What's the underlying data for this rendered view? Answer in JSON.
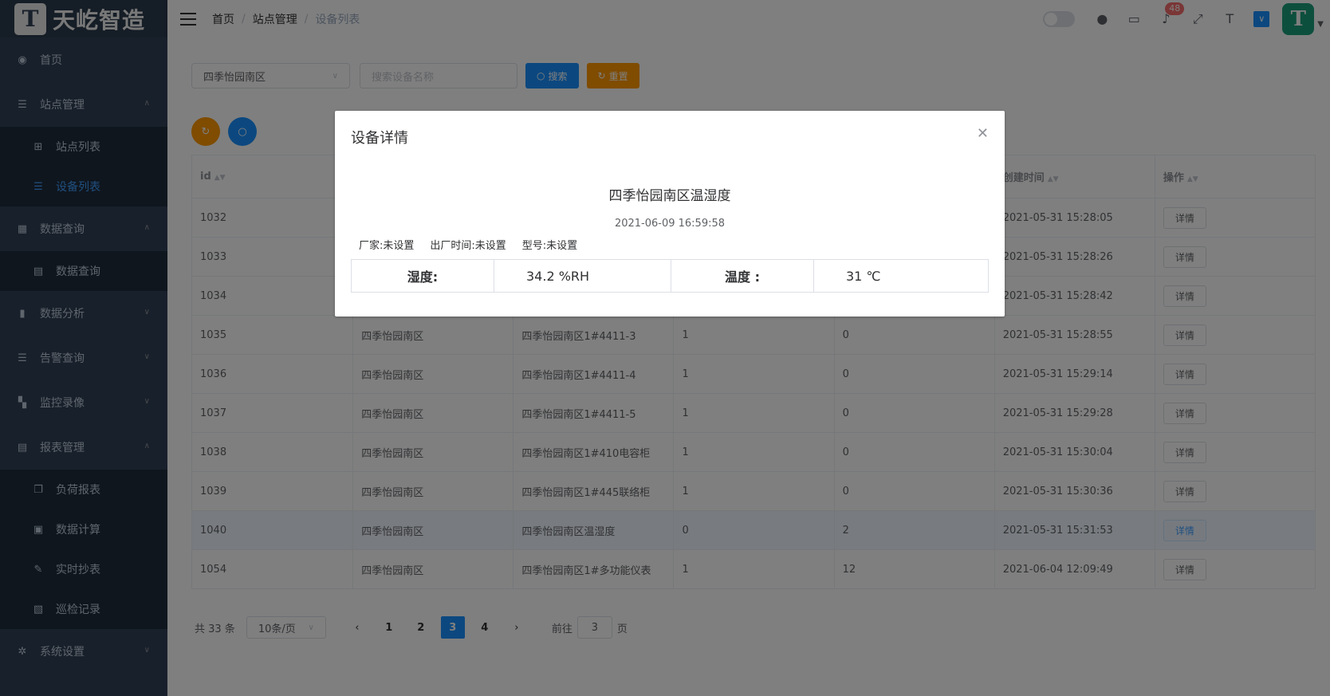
{
  "brand": {
    "logo_letter": "T",
    "name": "天屹智造"
  },
  "sidebar": {
    "items": [
      {
        "label": "首页",
        "icon": "dashboard-icon"
      },
      {
        "label": "站点管理",
        "icon": "list-icon",
        "expanded": true,
        "children": [
          {
            "label": "站点列表",
            "icon": "tree-table-icon"
          },
          {
            "label": "设备列表",
            "icon": "list-icon",
            "active": true
          }
        ]
      },
      {
        "label": "数据查询",
        "icon": "table-icon",
        "expanded": true,
        "children": [
          {
            "label": "数据查询",
            "icon": "book-icon"
          }
        ]
      },
      {
        "label": "数据分析",
        "icon": "chart-icon"
      },
      {
        "label": "告警查询",
        "icon": "list-icon"
      },
      {
        "label": "监控录像",
        "icon": "grid-icon"
      },
      {
        "label": "报表管理",
        "icon": "book-icon",
        "expanded": true,
        "children": [
          {
            "label": "负荷报表",
            "icon": "copy-icon"
          },
          {
            "label": "数据计算",
            "icon": "calendar-icon"
          },
          {
            "label": "实时抄表",
            "icon": "edit-doc-icon"
          },
          {
            "label": "巡检记录",
            "icon": "document-icon"
          }
        ]
      },
      {
        "label": "系统设置",
        "icon": "settings-icon"
      }
    ]
  },
  "header": {
    "breadcrumb": [
      "首页",
      "站点管理",
      "设备列表"
    ],
    "notification_count": "48",
    "avatar_letter": "T"
  },
  "filters": {
    "area_select": "四季怡园南区",
    "search_placeholder": "搜索设备名称",
    "search_label": "搜索",
    "reset_label": "重置"
  },
  "table": {
    "columns": [
      "id",
      "",
      "",
      "",
      "",
      "创建时间",
      "操作"
    ],
    "detail_label": "详情",
    "rows": [
      [
        "1032",
        "",
        "",
        "",
        "",
        "2021-05-31 15:28:05"
      ],
      [
        "1033",
        "",
        "",
        "",
        "",
        "2021-05-31 15:28:26"
      ],
      [
        "1034",
        "",
        "",
        "",
        "",
        "2021-05-31 15:28:42"
      ],
      [
        "1035",
        "四季怡园南区",
        "四季怡园南区1#4411-3",
        "1",
        "0",
        "2021-05-31 15:28:55"
      ],
      [
        "1036",
        "四季怡园南区",
        "四季怡园南区1#4411-4",
        "1",
        "0",
        "2021-05-31 15:29:14"
      ],
      [
        "1037",
        "四季怡园南区",
        "四季怡园南区1#4411-5",
        "1",
        "0",
        "2021-05-31 15:29:28"
      ],
      [
        "1038",
        "四季怡园南区",
        "四季怡园南区1#410电容柜",
        "1",
        "0",
        "2021-05-31 15:30:04"
      ],
      [
        "1039",
        "四季怡园南区",
        "四季怡园南区1#445联络柜",
        "1",
        "0",
        "2021-05-31 15:30:36"
      ],
      [
        "1040",
        "四季怡园南区",
        "四季怡园南区温湿度",
        "0",
        "2",
        "2021-05-31 15:31:53"
      ],
      [
        "1054",
        "四季怡园南区",
        "四季怡园南区1#多功能仪表",
        "1",
        "12",
        "2021-06-04 12:09:49"
      ]
    ],
    "highlight_row": 8
  },
  "pagination": {
    "total": "共 33 条",
    "page_size": "10条/页",
    "pages": [
      "1",
      "2",
      "3",
      "4"
    ],
    "current": "3",
    "goto_prefix": "前往",
    "goto_value": "3",
    "goto_suffix": "页"
  },
  "dialog": {
    "title": "设备详情",
    "device_name": "四季怡园南区温湿度",
    "time": "2021-06-09 16:59:58",
    "meta": [
      "厂家:未设置",
      "出厂时间:未设置",
      "型号:未设置"
    ],
    "readings": [
      {
        "label": "湿度:",
        "value": "34.2 %RH"
      },
      {
        "label": "温度 :",
        "value": "31 ℃"
      }
    ]
  },
  "colors": {
    "sidebar_bg": "#304156",
    "primary": "#1890ff",
    "warning": "#ff9900",
    "active_menu": "#409eff"
  }
}
